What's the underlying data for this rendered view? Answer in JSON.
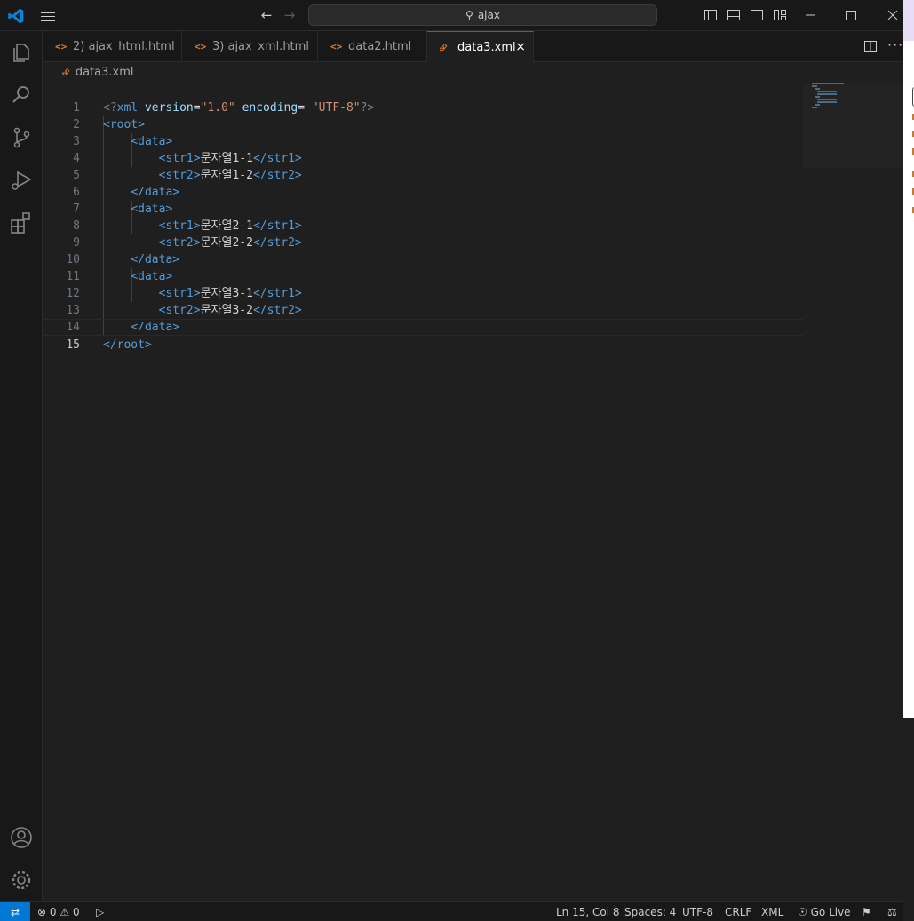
{
  "titlebar": {
    "search_text": "ajax",
    "back_icon": "arrow-left-icon",
    "forward_icon": "arrow-right-icon"
  },
  "tabs": [
    {
      "label": "2) ajax_html.html",
      "icon": "<>"
    },
    {
      "label": "3) ajax_xml.html",
      "icon": "<>"
    },
    {
      "label": "data2.html",
      "icon": "<>"
    },
    {
      "label": "data3.xml",
      "icon": "rss",
      "active": true,
      "close": "×"
    }
  ],
  "breadcrumb": {
    "file": "data3.xml"
  },
  "editor": {
    "current_line": 15,
    "lines": [
      {
        "n": "1"
      },
      {
        "n": "2"
      },
      {
        "n": "3"
      },
      {
        "n": "4"
      },
      {
        "n": "5"
      },
      {
        "n": "6"
      },
      {
        "n": "7"
      },
      {
        "n": "8"
      },
      {
        "n": "9"
      },
      {
        "n": "10"
      },
      {
        "n": "11"
      },
      {
        "n": "12"
      },
      {
        "n": "13"
      },
      {
        "n": "14"
      },
      {
        "n": "15"
      }
    ],
    "xml": {
      "decl_open": "<?",
      "decl_name": "xml",
      "attr_version": "version",
      "attr_encoding": "encoding",
      "eq": "=",
      "val_version": "\"1.0\"",
      "val_encoding": "\"UTF-8\"",
      "decl_close": "?>",
      "root_open": "<root>",
      "root_close": "</root>",
      "data_open": "<data>",
      "data_close": "</data>",
      "str1_open": "<str1>",
      "str1_close": "</str1>",
      "str2_open": "<str2>",
      "str2_close": "</str2>",
      "v11": "문자열1-1",
      "v12": "문자열1-2",
      "v21": "문자열2-1",
      "v22": "문자열2-2",
      "v31": "문자열3-1",
      "v32": "문자열3-2"
    }
  },
  "statusbar": {
    "errors": "0",
    "warnings": "0",
    "position": "Ln 15, Col 8",
    "spaces": "Spaces: 4",
    "encoding": "UTF-8",
    "eol": "CRLF",
    "language": "XML",
    "go_live": "Go Live"
  },
  "colors": {
    "accent": "#0078d4",
    "tag": "#569cd6",
    "attr": "#9cdcfe",
    "string": "#ce9178",
    "html_icon": "#e37933"
  }
}
